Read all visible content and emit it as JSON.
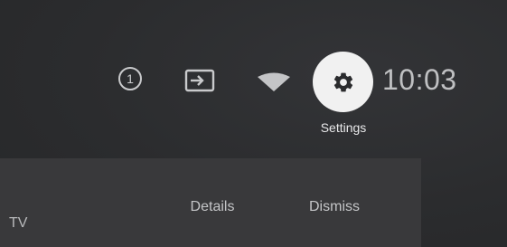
{
  "status_bar": {
    "notification_count": "1",
    "clock": "10:03",
    "settings_label": "Settings",
    "icons": {
      "notification": "notification-count-icon",
      "input": "input-source-icon",
      "network": "wifi-icon",
      "settings": "gear-icon"
    }
  },
  "notification_card": {
    "partial_text": "TV",
    "details_label": "Details",
    "dismiss_label": "Dismiss"
  },
  "colors": {
    "background": "#2a2b2d",
    "card": "#39393b",
    "settings_focus": "#f1f1f1",
    "text_primary": "#e8e8ea",
    "text_secondary": "#c4c5c7"
  }
}
